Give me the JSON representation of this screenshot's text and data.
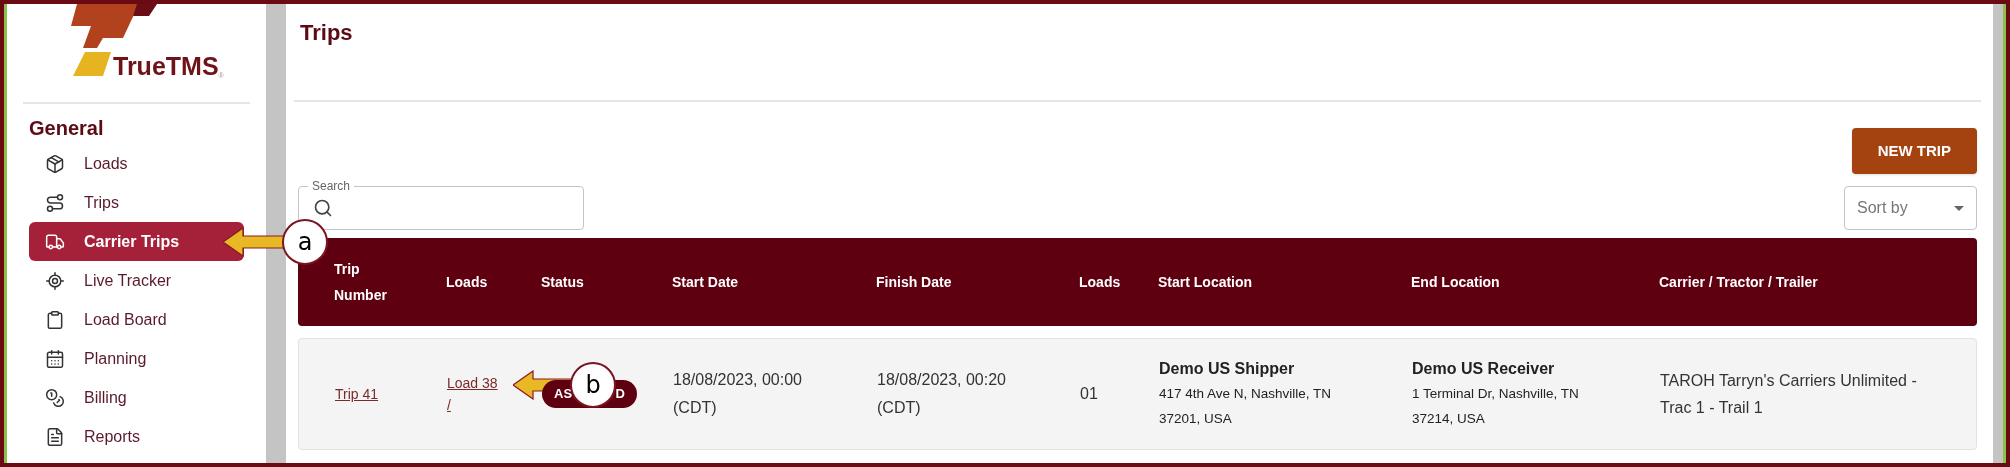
{
  "logo": {
    "name": "TrueTMS",
    "mark": "®"
  },
  "sidebar": {
    "section": "General",
    "items": [
      {
        "label": "Loads",
        "selected": false
      },
      {
        "label": "Trips",
        "selected": false
      },
      {
        "label": "Carrier Trips",
        "selected": true,
        "callout": "a"
      },
      {
        "label": "Live Tracker",
        "selected": false
      },
      {
        "label": "Load Board",
        "selected": false
      },
      {
        "label": "Planning",
        "selected": false
      },
      {
        "label": "Billing",
        "selected": false
      },
      {
        "label": "Reports",
        "selected": false
      }
    ]
  },
  "page": {
    "title": "Trips"
  },
  "new_trip_button": "NEW TRIP",
  "search": {
    "label": "Search"
  },
  "sort": {
    "placeholder": "Sort by"
  },
  "table": {
    "columns": [
      "Trip Number",
      "Loads",
      "Status",
      "Start Date",
      "Finish Date",
      "Loads",
      "Start Location",
      "End Location",
      "Carrier / Tractor / Trailer"
    ],
    "rows": [
      {
        "trip": "Trip 41",
        "loads": [
          "Load 38",
          "/"
        ],
        "loads_callout": "b",
        "status": {
          "kind": "assigned",
          "parts": [
            "AS",
            "D"
          ]
        },
        "start_date": [
          "18/08/2023, 00:00",
          "(CDT)"
        ],
        "finish_date": [
          "18/08/2023, 00:20",
          "(CDT)"
        ],
        "load_count": "01",
        "start_location": {
          "name": "Demo US Shipper",
          "address": [
            "417 4th Ave N, Nashville, TN",
            "37201, USA"
          ]
        },
        "end_location": {
          "name": "Demo US Receiver",
          "address": [
            "1 Terminal Dr, Nashville, TN",
            "37214, USA"
          ]
        },
        "carrier": [
          "TAROH Tarryn's Carriers Unlimited -",
          "Trac 1 - Trail 1"
        ]
      }
    ]
  }
}
